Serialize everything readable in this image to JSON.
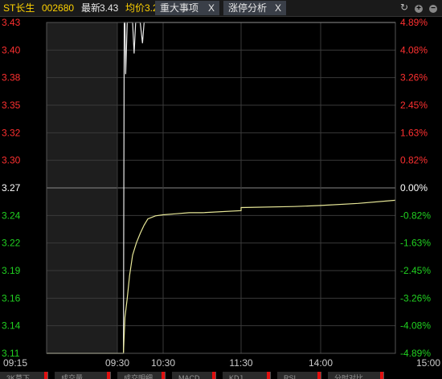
{
  "header": {
    "name": "ST长生",
    "code": "002680",
    "last_label": "最新",
    "last_value": "3.43",
    "avg_label": "均价",
    "avg_value": "3.2",
    "tabs": [
      {
        "label": "重大事项",
        "close": "X"
      },
      {
        "label": "涨停分析",
        "close": "X"
      }
    ],
    "controls": {
      "refresh": "↻",
      "zoom_in": "+",
      "zoom_out": "−"
    }
  },
  "colors": {
    "background": "#000000",
    "up": "#ff3030",
    "down": "#20d020",
    "flat": "#ffffff",
    "price_line": "#e8e8e8",
    "avg_line": "#e8e898",
    "grid": "#3a3a3a",
    "open_shade": "#1e1e1e"
  },
  "chart_data": {
    "type": "line",
    "x_ticks": [
      "09:15",
      "09:30",
      "10:30",
      "11:30",
      "14:00",
      "15:00"
    ],
    "y_ticks": [
      "3.43",
      "3.40",
      "3.38",
      "3.35",
      "3.32",
      "3.30",
      "3.27",
      "3.24",
      "3.22",
      "3.19",
      "3.16",
      "3.14",
      "3.11"
    ],
    "pct_ticks": [
      "4.89%",
      "4.08%",
      "3.26%",
      "2.45%",
      "1.63%",
      "0.82%",
      "0.00%",
      "-0.82%",
      "-1.63%",
      "-2.45%",
      "-3.26%",
      "-4.08%",
      "-4.89%"
    ],
    "prev_close": 3.27,
    "ylim": [
      3.11,
      3.43
    ],
    "series": [
      {
        "key": "price",
        "x": [
          "09:15",
          "09:30",
          "09:38",
          "09:39",
          "09:39",
          "09:40",
          "09:41",
          "09:43",
          "09:45",
          "09:47",
          "09:50",
          "09:52",
          "09:54",
          "09:57",
          "10:00",
          "10:03",
          "10:05",
          "10:08",
          "10:12",
          "15:00"
        ],
        "y": [
          3.11,
          3.11,
          3.11,
          3.43,
          3.43,
          3.43,
          3.38,
          3.43,
          3.43,
          3.43,
          3.43,
          3.4,
          3.43,
          3.43,
          3.43,
          3.41,
          3.43,
          3.43,
          3.43,
          3.43
        ]
      },
      {
        "key": "avg",
        "x": [
          "09:15",
          "09:30",
          "09:38",
          "09:40",
          "09:43",
          "09:46",
          "09:50",
          "09:55",
          "10:00",
          "10:05",
          "10:10",
          "10:20",
          "10:30",
          "10:40",
          "10:50",
          "11:00",
          "11:30",
          "13:00",
          "13:40",
          "14:00",
          "14:30",
          "15:00"
        ],
        "y": [
          3.11,
          3.11,
          3.11,
          3.145,
          3.163,
          3.185,
          3.205,
          3.217,
          3.226,
          3.234,
          3.24,
          3.243,
          3.244,
          3.245,
          3.246,
          3.246,
          3.248,
          3.251,
          3.252,
          3.253,
          3.255,
          3.258
        ]
      }
    ]
  },
  "bottom_tabs": [
    "3K莫下",
    "成交量",
    "成交明细",
    "MACD",
    "KDJ",
    "RSI",
    "分时对比"
  ]
}
